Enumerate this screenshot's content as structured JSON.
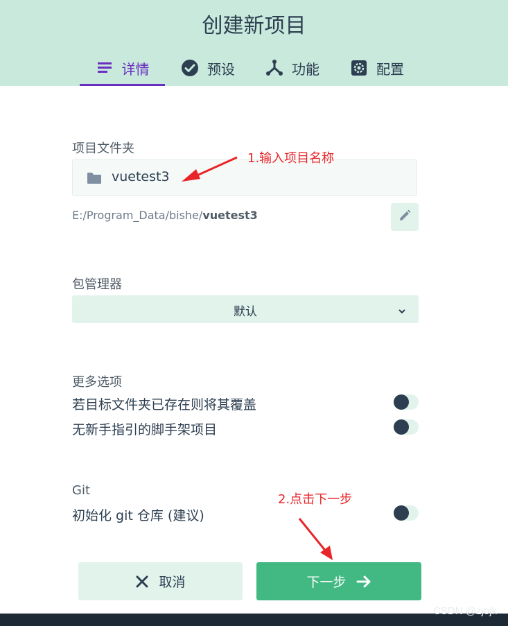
{
  "header": {
    "title": "创建新项目",
    "tabs": [
      {
        "label": "详情",
        "icon": "list-icon",
        "active": true
      },
      {
        "label": "预设",
        "icon": "check-circle-icon",
        "active": false
      },
      {
        "label": "功能",
        "icon": "fork-icon",
        "active": false
      },
      {
        "label": "配置",
        "icon": "gear-icon",
        "active": false
      }
    ],
    "accent": "#6a2fc1",
    "background": "#c8e9dc"
  },
  "form": {
    "folder_label": "项目文件夹",
    "folder_value": "vuetest3",
    "path_prefix": "E:/Program_Data/bishe/",
    "path_name": "vuetest3",
    "package_manager_label": "包管理器",
    "package_manager_value": "默认",
    "more_options_label": "更多选项",
    "options": [
      {
        "label": "若目标文件夹已存在则将其覆盖",
        "enabled": false
      },
      {
        "label": "无新手指引的脚手架项目",
        "enabled": false
      }
    ],
    "git_label": "Git",
    "git_option": {
      "label": "初始化 git 仓库 (建议)",
      "enabled": false
    }
  },
  "actions": {
    "cancel_label": "取消",
    "next_label": "下一步",
    "primary_color": "#42b983"
  },
  "annotations": {
    "step1": "1.输入项目名称",
    "step2": "2.点击下一步",
    "color": "#e8262a"
  },
  "watermark": "CSDN @zjojk"
}
